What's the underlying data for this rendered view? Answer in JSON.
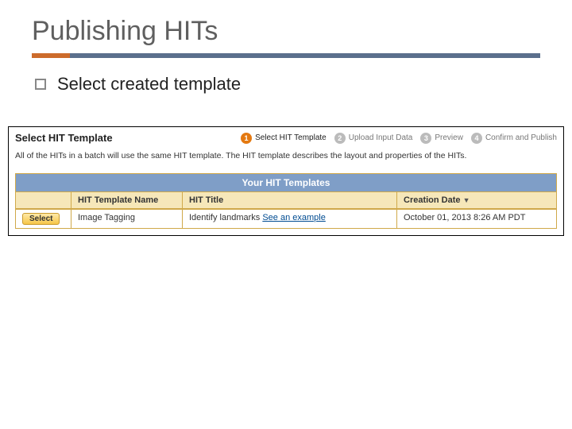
{
  "slide": {
    "title": "Publishing HITs",
    "bullet": "Select created template"
  },
  "panel": {
    "heading": "Select HIT Template",
    "steps": [
      {
        "num": "1",
        "label": "Select HIT Template",
        "active": true
      },
      {
        "num": "2",
        "label": "Upload Input Data",
        "active": false
      },
      {
        "num": "3",
        "label": "Preview",
        "active": false
      },
      {
        "num": "4",
        "label": "Confirm and Publish",
        "active": false
      }
    ],
    "description": "All of the HITs in a batch will use the same HIT template. The HIT template describes the layout and properties of the HITs.",
    "table": {
      "title": "Your HIT Templates",
      "headers": {
        "name": "HIT Template Name",
        "title": "HIT Title",
        "date": "Creation Date"
      },
      "row": {
        "select": "Select",
        "name": "Image Tagging",
        "title_text": "Identify landmarks ",
        "example_link": "See an example",
        "date": "October 01, 2013   8:26 AM PDT"
      }
    }
  }
}
